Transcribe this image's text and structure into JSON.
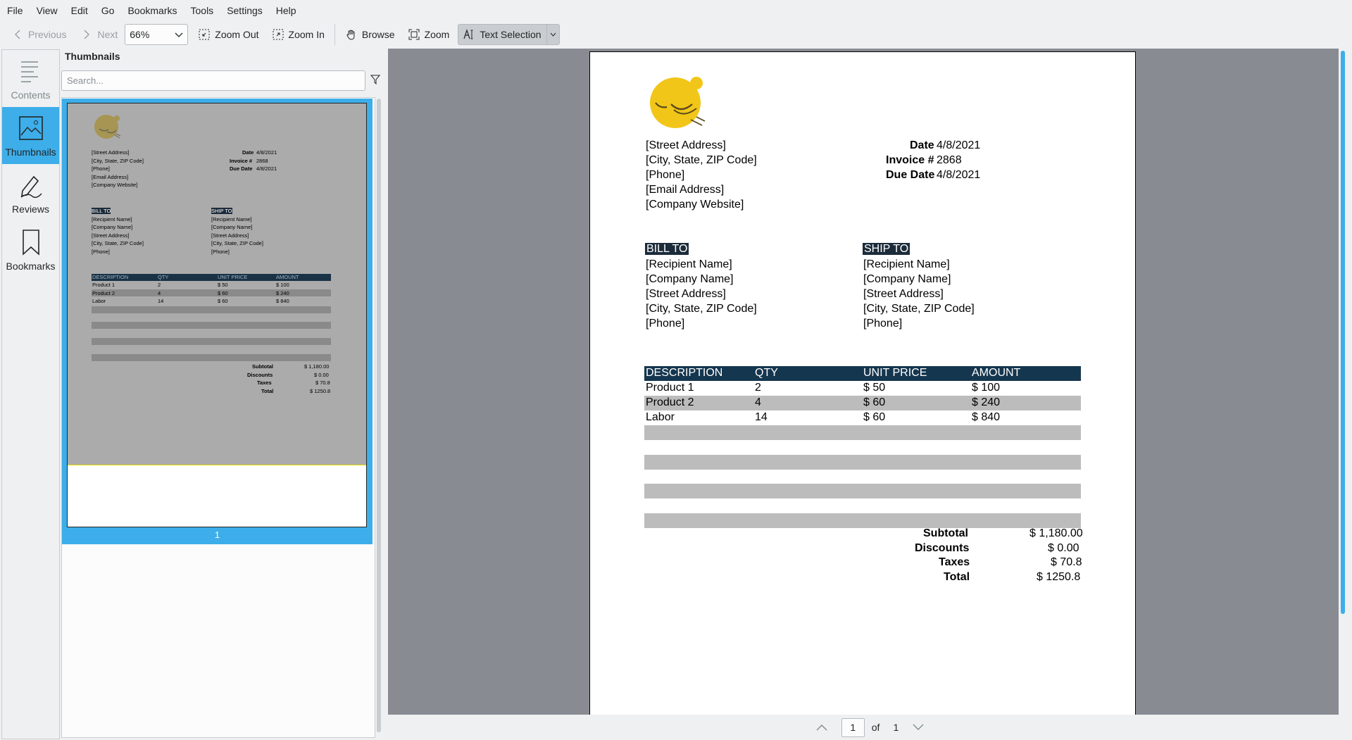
{
  "menu": [
    "File",
    "View",
    "Edit",
    "Go",
    "Bookmarks",
    "Tools",
    "Settings",
    "Help"
  ],
  "toolbar": {
    "previous": "Previous",
    "next": "Next",
    "zoom_value": "66%",
    "zoom_out": "Zoom Out",
    "zoom_in": "Zoom In",
    "browse": "Browse",
    "zoom": "Zoom",
    "text_selection": "Text Selection"
  },
  "sidebar": {
    "tabs": [
      {
        "label": "Contents",
        "icon": "contents-icon"
      },
      {
        "label": "Thumbnails",
        "icon": "thumbnails-icon"
      },
      {
        "label": "Reviews",
        "icon": "reviews-icon"
      },
      {
        "label": "Bookmarks",
        "icon": "bookmarks-icon"
      }
    ]
  },
  "thumbnails": {
    "title": "Thumbnails",
    "search_placeholder": "Search...",
    "page_label": "1"
  },
  "invoice": {
    "address": [
      "[Street Address]",
      "[City, State, ZIP Code]",
      "[Phone]",
      "[Email Address]",
      "[Company Website]"
    ],
    "date_label": "Date",
    "date_value": "4/8/2021",
    "invoice_label": "Invoice #",
    "invoice_value": "2868",
    "due_label": "Due Date",
    "due_value": "4/8/2021",
    "bill_to": "BILL TO",
    "ship_to": "SHIP TO",
    "bill_lines": [
      "[Recipient Name]",
      "[Company Name]",
      "[Street Address]",
      "[City, State, ZIP Code]",
      "[Phone]"
    ],
    "ship_lines": [
      "[Recipient Name]",
      "[Company Name]",
      "[Street Address]",
      "[City, State, ZIP Code]",
      "[Phone]"
    ],
    "columns": [
      "DESCRIPTION",
      "QTY",
      "UNIT PRICE",
      "AMOUNT"
    ],
    "items": [
      {
        "desc": "Product 1",
        "qty": "2",
        "price": "$ 50",
        "amount": "$ 100"
      },
      {
        "desc": "Product 2",
        "qty": "4",
        "price": "$ 60",
        "amount": "$ 240"
      },
      {
        "desc": "Labor",
        "qty": "14",
        "price": "$ 60",
        "amount": "$ 840"
      }
    ],
    "subtotal_label": "Subtotal",
    "subtotal_value": "$ 1,180.00",
    "discounts_label": "Discounts",
    "discounts_value": "$ 0.00",
    "taxes_label": "Taxes",
    "taxes_value": "$ 70.8",
    "total_label": "Total",
    "total_value": "$ 1250.8"
  },
  "pager": {
    "current": "1",
    "of_label": "of",
    "total": "1"
  },
  "colors": {
    "accent": "#3daee9",
    "table_header": "#15364f",
    "logo": "#f2c618"
  }
}
